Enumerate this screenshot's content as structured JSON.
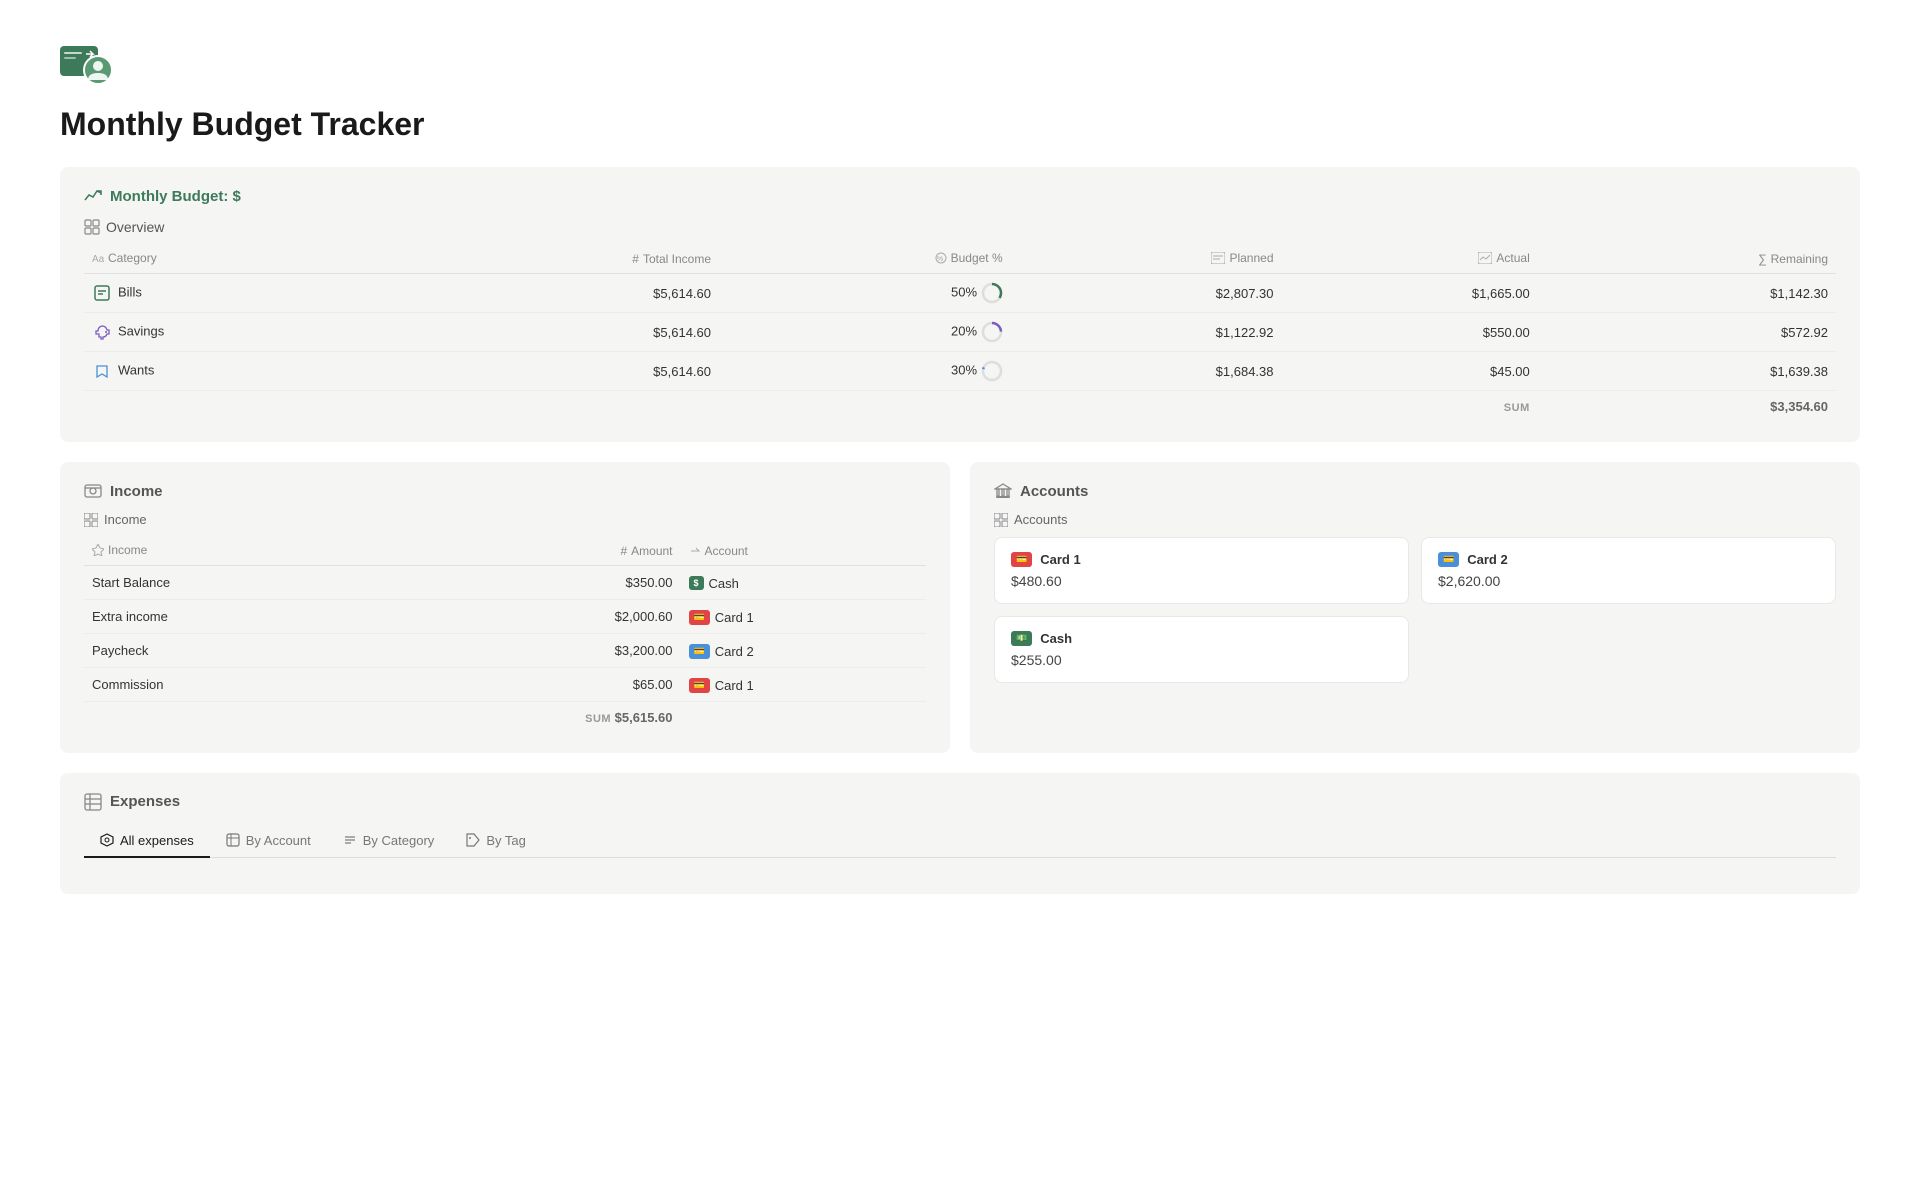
{
  "app": {
    "title": "Monthly Budget Tracker"
  },
  "monthly_budget": {
    "section_title": "Monthly Budget: $",
    "overview_label": "Overview",
    "columns": {
      "category": "Category",
      "total_income": "Total Income",
      "budget_pct": "Budget %",
      "planned": "Planned",
      "actual": "Actual",
      "remaining": "Remaining"
    },
    "rows": [
      {
        "name": "Bills",
        "icon": "bills",
        "icon_color": "#3d7a5a",
        "total_income": "$5,614.60",
        "budget_pct": "50%",
        "planned": "$2,807.30",
        "actual": "$1,665.00",
        "remaining": "$1,142.30",
        "progress": 59
      },
      {
        "name": "Savings",
        "icon": "savings",
        "icon_color": "#7c5cbf",
        "total_income": "$5,614.60",
        "budget_pct": "20%",
        "planned": "$1,122.92",
        "actual": "$550.00",
        "remaining": "$572.92",
        "progress": 49
      },
      {
        "name": "Wants",
        "icon": "wants",
        "icon_color": "#4a90d9",
        "total_income": "$5,614.60",
        "budget_pct": "30%",
        "planned": "$1,684.38",
        "actual": "$45.00",
        "remaining": "$1,639.38",
        "progress": 3
      }
    ],
    "sum_label": "SUM",
    "sum_value": "$3,354.60"
  },
  "income": {
    "section_title": "Income",
    "table_label": "Income",
    "columns": {
      "income": "Income",
      "amount": "Amount",
      "account": "Account"
    },
    "rows": [
      {
        "name": "Start Balance",
        "amount": "$350.00",
        "account": "Cash",
        "account_type": "cash"
      },
      {
        "name": "Extra income",
        "amount": "$2,000.60",
        "account": "Card 1",
        "account_type": "card1"
      },
      {
        "name": "Paycheck",
        "amount": "$3,200.00",
        "account": "Card 2",
        "account_type": "card2"
      },
      {
        "name": "Commission",
        "amount": "$65.00",
        "account": "Card 1",
        "account_type": "card1"
      }
    ],
    "sum_label": "SUM",
    "sum_value": "$5,615.60"
  },
  "accounts": {
    "section_title": "Accounts",
    "table_label": "Accounts",
    "items": [
      {
        "name": "Card 1",
        "type": "card1",
        "amount": "$480.60"
      },
      {
        "name": "Card 2",
        "type": "card2",
        "amount": "$2,620.00"
      },
      {
        "name": "Cash",
        "type": "cash",
        "amount": "$255.00"
      }
    ]
  },
  "expenses": {
    "section_title": "Expenses",
    "tabs": [
      {
        "label": "All expenses",
        "active": true
      },
      {
        "label": "By Account",
        "active": false
      },
      {
        "label": "By Category",
        "active": false
      },
      {
        "label": "By Tag",
        "active": false
      }
    ]
  }
}
